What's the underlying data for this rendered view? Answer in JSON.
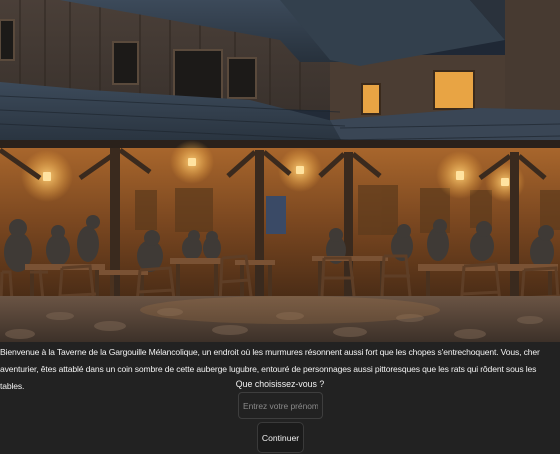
{
  "scene": {
    "image_subject": "tavern-courtyard-night-illustration"
  },
  "story": {
    "text": "Bienvenue à la Taverne de la Gargouille Mélancolique, un endroit où les murmures résonnent aussi fort que les chopes s'entrechoquent. Vous, cher aventurier, êtes attablé dans un coin sombre de cette auberge lugubre, entouré de personnages aussi pittoresques que les rats qui rôdent sous les tables."
  },
  "form": {
    "prompt": "Que choisissez-vous ?",
    "name_placeholder": "Entrez votre prénom",
    "name_value": "",
    "continue_label": "Continuer"
  },
  "colors": {
    "page_background": "#222222",
    "text": "#f2f2f2",
    "lantern_glow": "#f5b04a"
  }
}
